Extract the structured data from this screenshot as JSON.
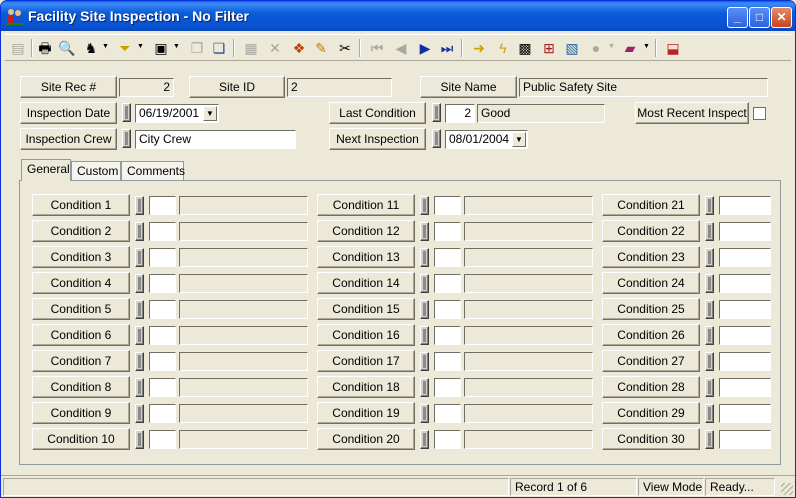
{
  "window": {
    "title": "Facility Site Inspection - No Filter",
    "controls": {
      "minimize": "_",
      "maximize": "□",
      "close": "✕"
    }
  },
  "toolbar": {
    "icons": [
      "view-icon",
      "print-icon",
      "print-preview-icon",
      "find-icon",
      "filter-icon",
      "new-record-icon",
      "copy-record-icon",
      "paste-icon",
      "save-icon",
      "delete-icon",
      "layers-icon",
      "edit-pencil-icon",
      "cut-icon",
      "first-record-icon",
      "previous-record-icon",
      "next-record-icon",
      "last-record-icon",
      "go-to-icon",
      "lightning-icon",
      "map-icon",
      "tree-icon",
      "report-icon",
      "globe-icon",
      "books-icon",
      "close-form-icon"
    ]
  },
  "header": {
    "site_rec_label": "Site Rec #",
    "site_rec_value": "2",
    "site_id_label": "Site ID",
    "site_id_value": "2",
    "site_name_label": "Site Name",
    "site_name_value": "Public Safety Site",
    "inspection_date_label": "Inspection Date",
    "inspection_date_value": "06/19/2001",
    "last_condition_label": "Last Condition",
    "last_condition_code": "2",
    "last_condition_text": "Good",
    "most_recent_label": "Most Recent Inspect",
    "inspection_crew_label": "Inspection Crew",
    "inspection_crew_value": "City Crew",
    "next_inspection_label": "Next Inspection",
    "next_inspection_value": "08/01/2004"
  },
  "tabs": [
    "General",
    "Custom",
    "Comments"
  ],
  "conditions": {
    "col1": [
      "Condition 1",
      "Condition 2",
      "Condition 3",
      "Condition 4",
      "Condition 5",
      "Condition 6",
      "Condition 7",
      "Condition 8",
      "Condition 9",
      "Condition 10"
    ],
    "col2": [
      "Condition 11",
      "Condition 12",
      "Condition 13",
      "Condition 14",
      "Condition 15",
      "Condition 16",
      "Condition 17",
      "Condition 18",
      "Condition 19",
      "Condition 20"
    ],
    "col3": [
      "Condition 21",
      "Condition 22",
      "Condition 23",
      "Condition 24",
      "Condition 25",
      "Condition 26",
      "Condition 27",
      "Condition 28",
      "Condition 29",
      "Condition 30"
    ]
  },
  "status": {
    "record": "Record 1 of 6",
    "mode": "View Mode",
    "state": "Ready..."
  },
  "colors": {
    "titlebar": "#0a5fe6",
    "face": "#ece9d8"
  }
}
